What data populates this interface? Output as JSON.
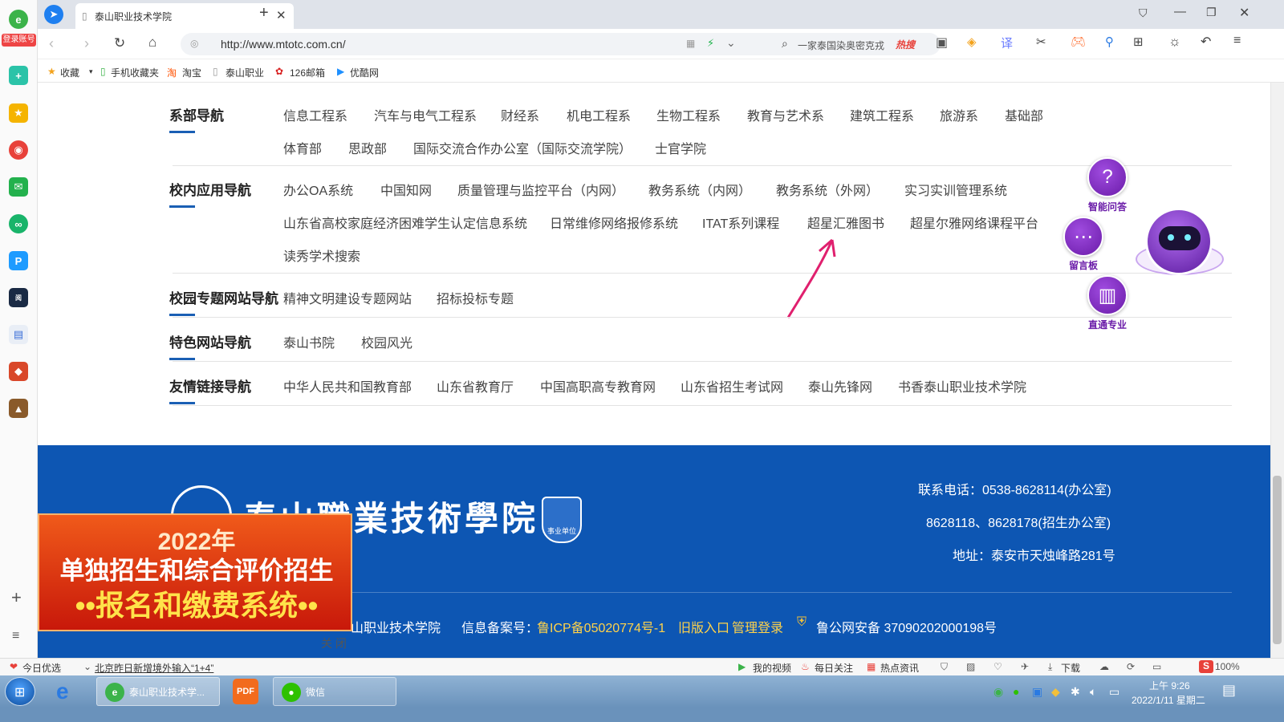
{
  "browser": {
    "tab_title": "泰山职业技术学院",
    "url": "http://www.mtotc.com.cn/",
    "search_text": "一家泰国染奥密克戎",
    "search_tag": "热搜",
    "login_badge": "登录账号"
  },
  "bookmarks": [
    "收藏",
    "手机收藏夹",
    "淘宝",
    "泰山职业",
    "126邮箱",
    "优酷网"
  ],
  "nav_groups": [
    {
      "title": "系部导航",
      "links": [
        "信息工程系",
        "汽车与电气工程系",
        "财经系",
        "机电工程系",
        "生物工程系",
        "教育与艺术系",
        "建筑工程系",
        "旅游系",
        "基础部",
        "体育部",
        "思政部",
        "国际交流合作办公室（国际交流学院）",
        "士官学院"
      ]
    },
    {
      "title": "校内应用导航",
      "links": [
        "办公OA系统",
        "中国知网",
        "质量管理与监控平台（内网）",
        "教务系统（内网）",
        "教务系统（外网）",
        "实习实训管理系统",
        "山东省高校家庭经济困难学生认定信息系统",
        "日常维修网络报修系统",
        "ITAT系列课程",
        "超星汇雅图书",
        "超星尔雅网络课程平台",
        "读秀学术搜索"
      ]
    },
    {
      "title": "校园专题网站导航",
      "links": [
        "精神文明建设专题网站",
        "招标投标专题"
      ]
    },
    {
      "title": "特色网站导航",
      "links": [
        "泰山书院",
        "校园风光"
      ]
    },
    {
      "title": "友情链接导航",
      "links": [
        "中华人民共和国教育部",
        "山东省教育厅",
        "中国高职高专教育网",
        "山东省招生考试网",
        "泰山先锋网",
        "书香泰山职业技术学院"
      ]
    }
  ],
  "float_buttons": {
    "qa": "智能问答",
    "board": "留言板",
    "major": "直通专业"
  },
  "footer": {
    "logo_text": "泰山職業技術學院",
    "badge_text": "事业单位",
    "phone": "联系电话：0538-8628114(办公室)",
    "phone2": "8628118、8628178(招生办公室)",
    "address": "地址：泰安市天烛峰路281号",
    "copyright": "山职业技术学院",
    "record_label": "信息备案号：",
    "icp": "鲁ICP备05020774号-1",
    "old_entry": "旧版入口",
    "admin_login": "管理登录",
    "police": "鲁公网安备 37090202000198号"
  },
  "promo": {
    "year": "2022年",
    "line1": "单独招生和综合评价招生",
    "line2": "••报名和缴费系统••",
    "close": "关 闭"
  },
  "status": {
    "left": "今日优选",
    "news": "北京昨日新增境外输入“1+4”",
    "items": [
      "我的视频",
      "每日关注",
      "热点资讯",
      "下载"
    ],
    "zoom": "100%"
  },
  "taskbar": {
    "task1": "泰山职业技术学...",
    "task3": "微信",
    "time": "上午 9:26",
    "date": "2022/1/11 星期二"
  },
  "colors": {
    "footer_blue": "#0d56b3",
    "accent_purple": "#6a1ba8",
    "link_yellow": "#ffd24a"
  }
}
